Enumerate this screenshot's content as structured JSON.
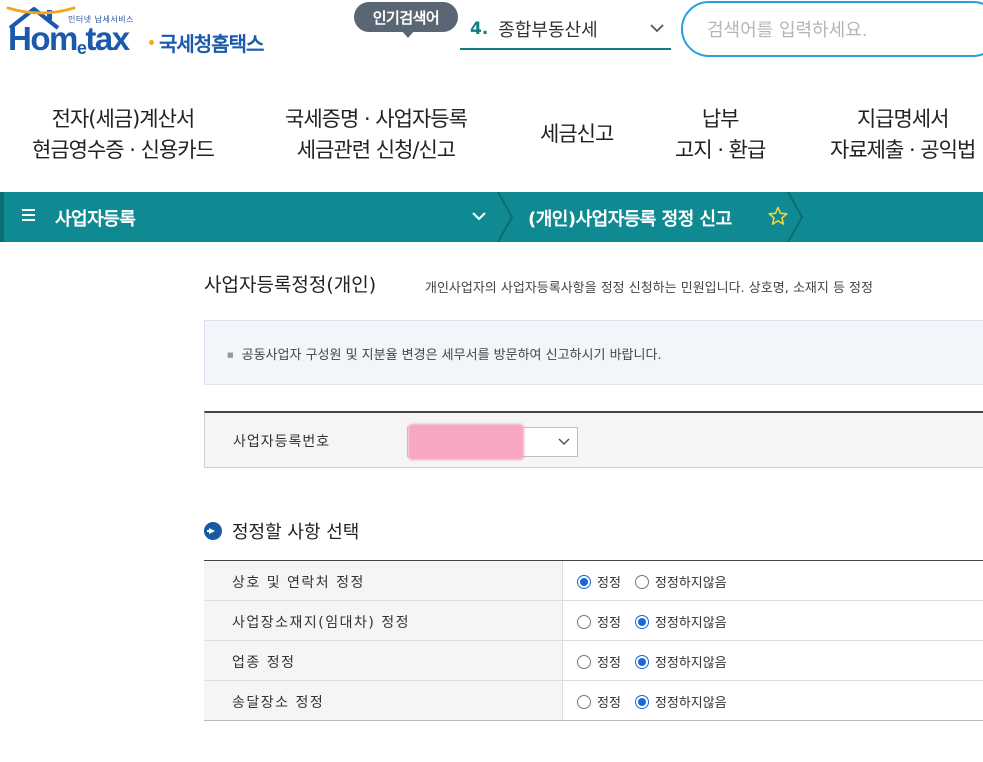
{
  "logo": {
    "tagline": "인터넷 납세서비스",
    "brand_home": "Hom",
    "brand_e": "e",
    "brand_tax": "tax",
    "brand_kr": "국세청홈택스"
  },
  "popular": {
    "badge": "인기검색어",
    "rank": "4.",
    "term": "종합부동산세"
  },
  "search": {
    "placeholder": "검색어를 입력하세요."
  },
  "nav": [
    {
      "line1": "전자(세금)계산서",
      "line2": "현금영수증 · 신용카드"
    },
    {
      "line1": "국세증명 · 사업자등록",
      "line2": "세금관련 신청/신고"
    },
    {
      "line1": "세금신고",
      "line2": ""
    },
    {
      "line1": "납부",
      "line2": "고지 · 환급"
    },
    {
      "line1": "지급명세서",
      "line2": "자료제출 · 공익법"
    }
  ],
  "bar": {
    "title": "사업자등록",
    "page": "(개인)사업자등록 정정 신고"
  },
  "page": {
    "title": "사업자등록정정(개인)",
    "description": "개인사업자의 사업자등록사항을 정정 신청하는 민원입니다. 상호명, 소재지 등 정정"
  },
  "notice": "공동사업자 구성원 및 지분율 변경은 세무서를 방문하여 신고하시기 바랍니다.",
  "biz": {
    "label": "사업자등록번호"
  },
  "section": {
    "title": "정정할 사항 선택"
  },
  "choices": {
    "yes": "정정",
    "no": "정정하지않음"
  },
  "options": [
    {
      "label": "상호 및 연락처 정정",
      "selected": "yes"
    },
    {
      "label": "사업장소재지(임대차) 정정",
      "selected": "no"
    },
    {
      "label": "업종 정정",
      "selected": "no"
    },
    {
      "label": "송달장소 정정",
      "selected": "no"
    }
  ],
  "colors": {
    "teal": "#0f8a93",
    "brand_blue": "#1a59ad",
    "radio_blue": "#1a67d6"
  }
}
